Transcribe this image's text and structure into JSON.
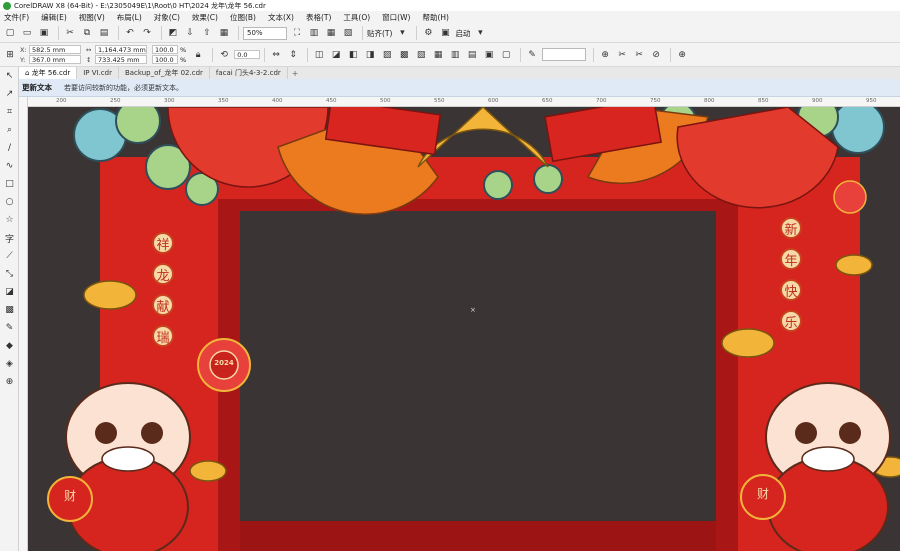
{
  "titlebar": {
    "title": "CorelDRAW X8 (64-Bit) - E:\\2305049E\\1\\Root\\0 HT\\2024 龙年\\龙年 56.cdr"
  },
  "menu": [
    "文件(F)",
    "编辑(E)",
    "视图(V)",
    "布局(L)",
    "对象(C)",
    "效果(C)",
    "位图(B)",
    "文本(X)",
    "表格(T)",
    "工具(O)",
    "窗口(W)",
    "帮助(H)"
  ],
  "toolbar": {
    "zoom": "50%",
    "snap_label": "贴齐(T)",
    "launch_label": "启动"
  },
  "properties": {
    "x": "582.5 mm",
    "y": "367.0 mm",
    "width": "1,164.473 mm",
    "height": "733.425 mm",
    "scale_w": "100.0",
    "scale_h": "100.0",
    "percent": "%",
    "rotation": "0.0"
  },
  "tabs": [
    "龙年 56.cdr",
    "IP VI.cdr",
    "Backup_of_龙年 02.cdr",
    "facai 门头4-3-2.cdr"
  ],
  "hint": {
    "title": "更新文本",
    "message": "若要访问较新的功能，必须更新文本。"
  },
  "ruler_h_ticks": [
    "200",
    "250",
    "300",
    "350",
    "400",
    "450",
    "500",
    "550",
    "600",
    "650",
    "700",
    "750",
    "800",
    "850",
    "900",
    "950"
  ],
  "artwork": {
    "left_chars": [
      "祥",
      "龙",
      "献",
      "瑞"
    ],
    "right_chars": [
      "新",
      "年",
      "快",
      "乐"
    ],
    "badge": "2024",
    "coin_char": "财"
  },
  "colors": {
    "red": "#d6241f",
    "dark_red": "#9c1414",
    "gold": "#f2b53a",
    "orange": "#ec7a1f",
    "cloud_teal": "#7fc6d0",
    "cloud_green": "#a8d48a"
  }
}
